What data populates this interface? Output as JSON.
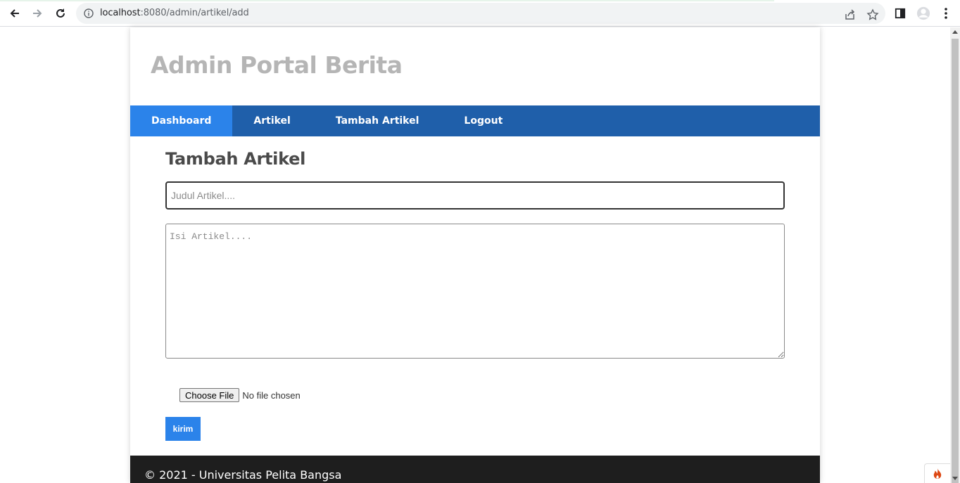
{
  "browser": {
    "url_host": "localhost",
    "url_rest": ":8080/admin/artikel/add",
    "icons": [
      "back-arrow-icon",
      "forward-arrow-icon",
      "reload-icon",
      "info-icon",
      "share-icon",
      "star-icon",
      "side-panel-icon",
      "profile-icon",
      "menu-dots-icon"
    ]
  },
  "header": {
    "site_title": "Admin Portal Berita"
  },
  "navbar": {
    "items": [
      {
        "label": "Dashboard",
        "active": true
      },
      {
        "label": "Artikel",
        "active": false
      },
      {
        "label": "Tambah Artikel",
        "active": false
      },
      {
        "label": "Logout",
        "active": false
      }
    ]
  },
  "form": {
    "heading": "Tambah Artikel",
    "title_placeholder": "Judul Artikel....",
    "title_value": "",
    "body_placeholder": "Isi Artikel....",
    "body_value": "",
    "file_button_label": "Choose File",
    "file_status": "No file chosen",
    "submit_label": "kirim"
  },
  "footer": {
    "text": "© 2021 - Universitas Pelita Bangsa"
  },
  "colors": {
    "navbar_bg": "#1f5faa",
    "nav_active_bg": "#2b83ea",
    "submit_bg": "#2b83ea",
    "footer_bg": "#1e1e1e",
    "title_color": "#b5b5b5"
  }
}
